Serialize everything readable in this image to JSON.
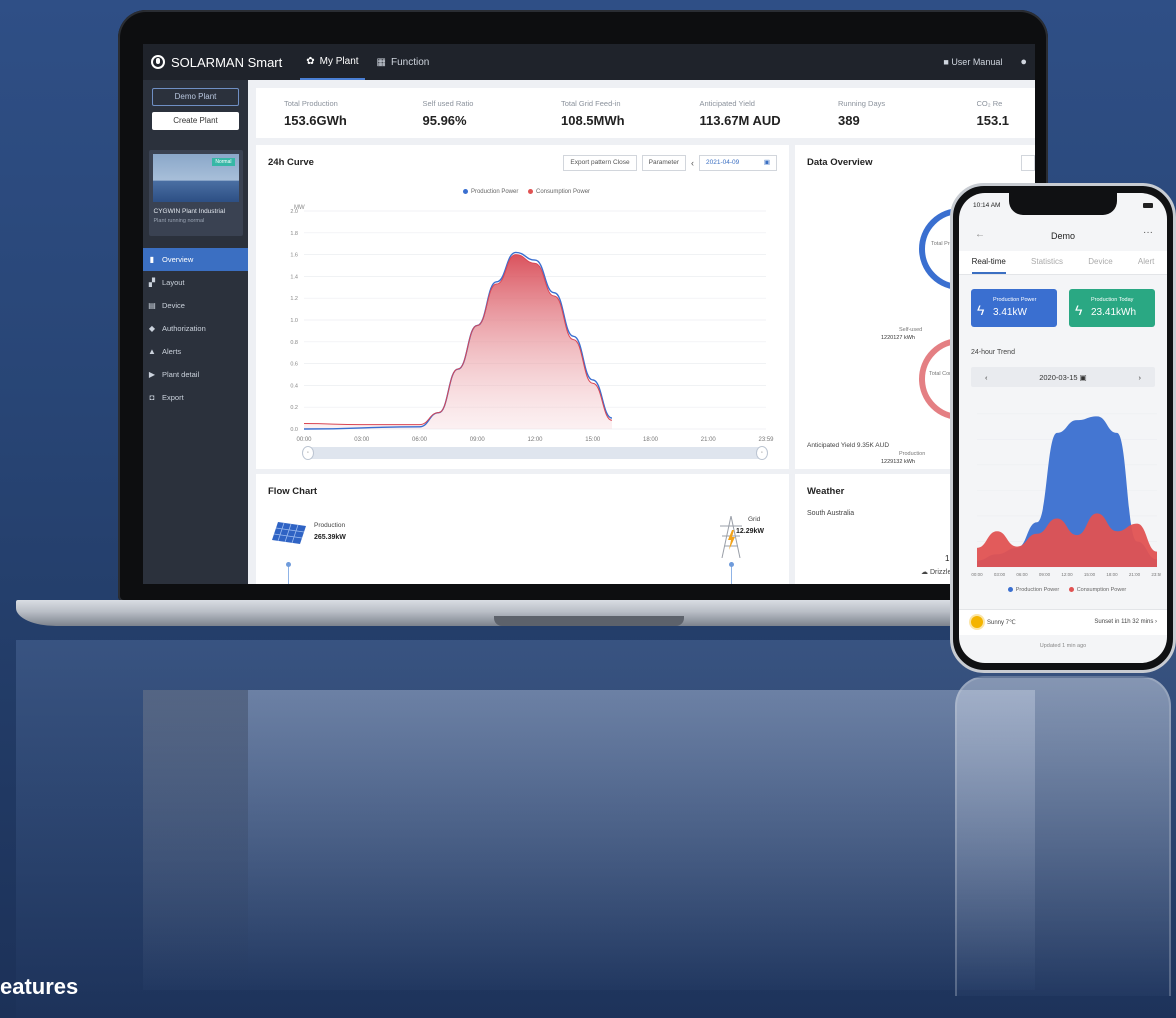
{
  "app": {
    "brand": "SOLARMAN Smart",
    "nav_tabs": [
      {
        "label": "My Plant",
        "active": true
      },
      {
        "label": "Function",
        "active": false
      }
    ],
    "user_manual": "User Manual"
  },
  "sidebar": {
    "demo_button": "Demo Plant",
    "create_button": "Create Plant",
    "plant_card": {
      "badge": "Normal",
      "name": "CYGWIN Plant Industrial",
      "status": "Plant running normal"
    },
    "menu": [
      {
        "label": "Overview",
        "icon": "chart-icon",
        "active": true
      },
      {
        "label": "Layout",
        "icon": "layout-icon",
        "active": false
      },
      {
        "label": "Device",
        "icon": "device-icon",
        "active": false
      },
      {
        "label": "Authorization",
        "icon": "shield-icon",
        "active": false
      },
      {
        "label": "Alerts",
        "icon": "alert-icon",
        "active": false
      },
      {
        "label": "Plant detail",
        "icon": "detail-icon",
        "active": false
      },
      {
        "label": "Export",
        "icon": "export-icon",
        "active": false
      }
    ]
  },
  "kpis": [
    {
      "label": "Total Production",
      "value": "153.6GWh"
    },
    {
      "label": "Self used Ratio",
      "value": "95.96%"
    },
    {
      "label": "Total Grid Feed-in",
      "value": "108.5MWh"
    },
    {
      "label": "Anticipated Yield",
      "value": "113.67M AUD"
    },
    {
      "label": "Running Days",
      "value": "389"
    },
    {
      "label": "CO₂ Re",
      "value": "153.1"
    }
  ],
  "curve_panel": {
    "title": "24h Curve",
    "btn_export": "Export pattern Close",
    "btn_param": "Parameter",
    "date": "2021-04-09",
    "legend": [
      "Production Power",
      "Consumption Power"
    ]
  },
  "overview_panel": {
    "title": "Data Overview",
    "ring1_center": "Total Production",
    "ring1_value": "1220127 kWh",
    "ring1_sub": "Self-used",
    "ring2_center": "Total Consumption",
    "ring2_value": "1229132 kWh",
    "ring2_sub": "Production",
    "footer": "Anticipated Yield 9.35K AUD"
  },
  "flow_panel": {
    "title": "Flow Chart",
    "production_label": "Production",
    "production_value": "265.39kW",
    "grid_label": "Grid",
    "grid_value": "12.29kW"
  },
  "weather_panel": {
    "title": "Weather",
    "location": "South Australia",
    "temp": "1",
    "condition": "Drizzle"
  },
  "phone": {
    "time": "10:14 AM",
    "title": "Demo",
    "tabs": [
      {
        "label": "Real-time",
        "active": true
      },
      {
        "label": "Statistics",
        "active": false
      },
      {
        "label": "Device",
        "active": false
      },
      {
        "label": "Alert",
        "active": false
      }
    ],
    "card1_label": "Production Power",
    "card1_value": "3.41kW",
    "card2_label": "Production Today",
    "card2_value": "23.41kWh",
    "trend_title": "24-hour Trend",
    "date": "2020-03-15",
    "legend": [
      "Production Power",
      "Consumption Power"
    ],
    "weather": "Sunny 7℃",
    "sunset": "Sunset in 11h 32 mins",
    "updated": "Updated 1 min ago"
  },
  "caption": "eatures",
  "colors": {
    "production": "#3a6fd0",
    "consumption": "#e05252",
    "accent": "#3b6fc2",
    "sidebar": "#2b313c"
  },
  "chart_data": [
    {
      "type": "area",
      "title": "24h Curve",
      "ylabel": "MW",
      "x": [
        "00:00",
        "03:00",
        "06:00",
        "09:00",
        "12:00",
        "15:00",
        "18:00",
        "21:00",
        "23:59"
      ],
      "yticks": [
        0,
        0.2,
        0.4,
        0.6,
        0.8,
        1.0,
        1.2,
        1.4,
        1.6,
        1.8,
        2.0
      ],
      "ylim": [
        0,
        2.0
      ],
      "series": [
        {
          "name": "Production Power",
          "hours": [
            0,
            6,
            7,
            8,
            9,
            10,
            11,
            12,
            13,
            14,
            15,
            16
          ],
          "values": [
            0.0,
            0.02,
            0.15,
            0.55,
            0.95,
            1.35,
            1.62,
            1.55,
            1.25,
            0.85,
            0.45,
            0.1
          ]
        },
        {
          "name": "Consumption Power",
          "hours": [
            0,
            3,
            6,
            7,
            8,
            9,
            10,
            11,
            12,
            13,
            14,
            15,
            16
          ],
          "values": [
            0.05,
            0.04,
            0.04,
            0.15,
            0.55,
            0.95,
            1.33,
            1.6,
            1.52,
            1.22,
            0.82,
            0.42,
            0.08
          ]
        }
      ]
    },
    {
      "type": "area",
      "title": "24-hour Trend",
      "x": [
        "00:00",
        "03:00",
        "06:00",
        "09:00",
        "12:00",
        "15:00",
        "18:00",
        "21:00",
        "23:59"
      ],
      "series": [
        {
          "name": "Production Power",
          "values": [
            0.5,
            1.0,
            1.5,
            3.5,
            10.5,
            11.5,
            11.8,
            10.5,
            2.0,
            0.6
          ]
        },
        {
          "name": "Consumption Power",
          "values": [
            1.5,
            2.8,
            1.6,
            2.6,
            3.8,
            2.5,
            4.2,
            2.8,
            3.4,
            1.2
          ]
        }
      ]
    }
  ]
}
